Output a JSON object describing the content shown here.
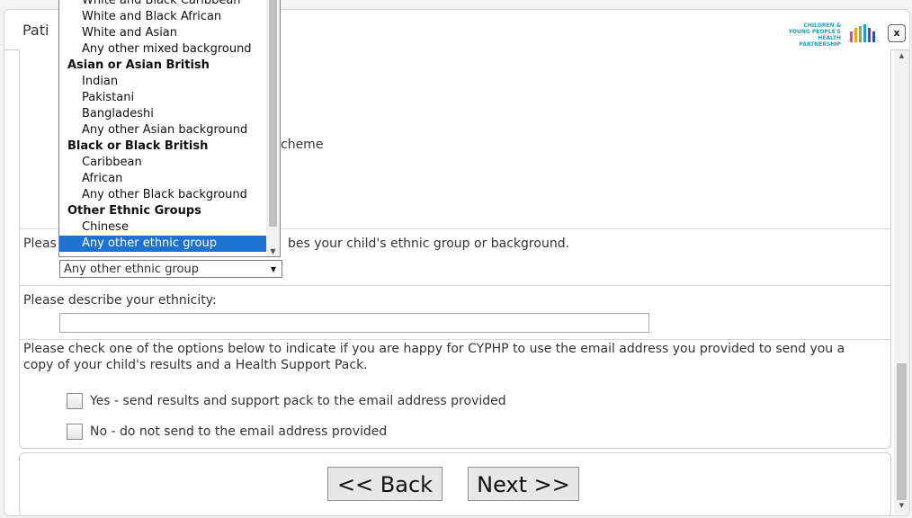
{
  "window": {
    "title": "Pati",
    "logo_text": [
      "CHILDREN &",
      "YOUNG PEOPLE'S",
      "HEALTH PARTNERSHIP"
    ],
    "close_label": "x"
  },
  "form": {
    "partial_text": "cheme",
    "ethnic_prompt_left": "Pleas",
    "ethnic_prompt_right": "bes your child's ethnic group or background.",
    "ethnic_selected": "Any other ethnic group",
    "describe_label": "Please describe your ethnicity:",
    "describe_value": "",
    "consent_text": "Please check one of the options below to indicate if you are happy for CYPHP to use the email address you provided to send you a copy of your child's results and a Health Support Pack.",
    "option_yes": "Yes - send results and support pack to the email address provided",
    "option_no": "No - do not send to the email address provided"
  },
  "nav": {
    "back_label": "<< Back",
    "next_label": "Next >>"
  },
  "dropdown": {
    "items": [
      {
        "label": "White and Black Caribbean",
        "kind": "option"
      },
      {
        "label": "White and Black African",
        "kind": "option"
      },
      {
        "label": "White and Asian",
        "kind": "option"
      },
      {
        "label": "Any other mixed background",
        "kind": "option"
      },
      {
        "label": "Asian or Asian British",
        "kind": "group"
      },
      {
        "label": "Indian",
        "kind": "option"
      },
      {
        "label": "Pakistani",
        "kind": "option"
      },
      {
        "label": "Bangladeshi",
        "kind": "option"
      },
      {
        "label": "Any other Asian background",
        "kind": "option"
      },
      {
        "label": "Black or Black British",
        "kind": "group"
      },
      {
        "label": "Caribbean",
        "kind": "option"
      },
      {
        "label": "African",
        "kind": "option"
      },
      {
        "label": "Any other Black background",
        "kind": "option"
      },
      {
        "label": "Other Ethnic Groups",
        "kind": "group"
      },
      {
        "label": "Chinese",
        "kind": "option"
      },
      {
        "label": "Any other ethnic group",
        "kind": "option",
        "selected": true
      }
    ]
  },
  "colors": {
    "selection": "#1e73d2",
    "logo": "#1ca0c8"
  }
}
